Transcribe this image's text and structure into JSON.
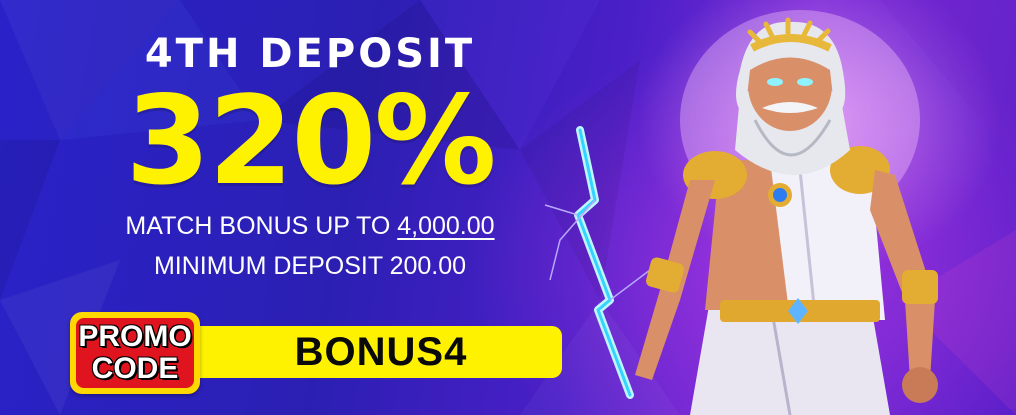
{
  "offer": {
    "headline": "4TH DEPOSIT",
    "percent": "320%",
    "match_prefix": "MATCH BONUS UP TO",
    "match_amount": "4,000.00",
    "minimum": "MINIMUM DEPOSIT 200.00"
  },
  "promo": {
    "badge_line1": "PROMO",
    "badge_line2": "CODE",
    "code": "BONUS4"
  },
  "colors": {
    "background": "#2b1fb3",
    "accent_yellow": "#fff200",
    "badge_red": "#e0141e",
    "text_white": "#ffffff"
  },
  "icons": {
    "character": "zeus-with-lightning-illustration"
  }
}
